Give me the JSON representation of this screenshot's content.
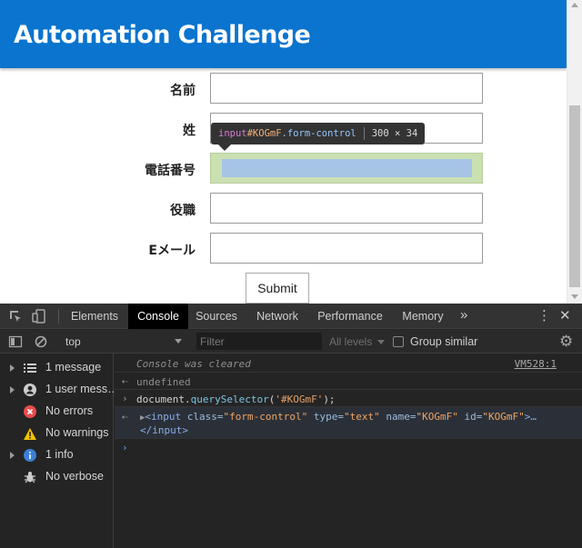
{
  "page": {
    "header_title": "Automation Challenge",
    "fields": [
      {
        "label": "名前",
        "value": ""
      },
      {
        "label": "姓",
        "value": ""
      },
      {
        "label": "電話番号",
        "value": ""
      },
      {
        "label": "役職",
        "value": ""
      },
      {
        "label": "Eメール",
        "value": ""
      }
    ],
    "submit_label": "Submit",
    "tooltip": {
      "tag": "input",
      "id": "#KOGmF",
      "class": ".form-control",
      "size": "300 × 34"
    }
  },
  "devtools": {
    "tabs": [
      "Elements",
      "Console",
      "Sources",
      "Network",
      "Performance",
      "Memory"
    ],
    "active_tab": "Console",
    "more_tabs": "»",
    "toolbar": {
      "context": "top",
      "filter_placeholder": "Filter",
      "levels": "All levels",
      "group_similar": "Group similar"
    },
    "sidebar": [
      {
        "label": "1 message",
        "icon": "list-icon",
        "expandable": true
      },
      {
        "label": "1 user mess…",
        "icon": "user-icon",
        "expandable": true
      },
      {
        "label": "No errors",
        "icon": "error-icon",
        "expandable": false
      },
      {
        "label": "No warnings",
        "icon": "warning-icon",
        "expandable": false
      },
      {
        "label": "1 info",
        "icon": "info-icon",
        "expandable": true
      },
      {
        "label": "No verbose",
        "icon": "bug-icon",
        "expandable": false
      }
    ],
    "console": {
      "cleared": "Console was cleared",
      "cleared_source": "VM528:1",
      "undefined_result": "undefined",
      "command_object": "document.",
      "command_method": "querySelector",
      "command_open": "(",
      "command_arg": "'#KOGmF'",
      "command_close": ");",
      "result_tag_open": "<input",
      "attr_class_name": "class=",
      "attr_class_value": "\"form-control\"",
      "attr_type_name": "type=",
      "attr_type_value": "\"text\"",
      "attr_name_name": "name=",
      "attr_name_value": "\"KOGmF\"",
      "attr_id_name": "id=",
      "attr_id_value": "\"KOGmF\"",
      "result_tag_end": ">…",
      "result_close_tag": "</input>"
    },
    "colors": {
      "header_blue": "#0a74cf",
      "devtools_bg": "#242424",
      "error_red": "#e84b4b",
      "warning_yellow": "#f2c200",
      "info_blue": "#3c7fd9"
    }
  }
}
